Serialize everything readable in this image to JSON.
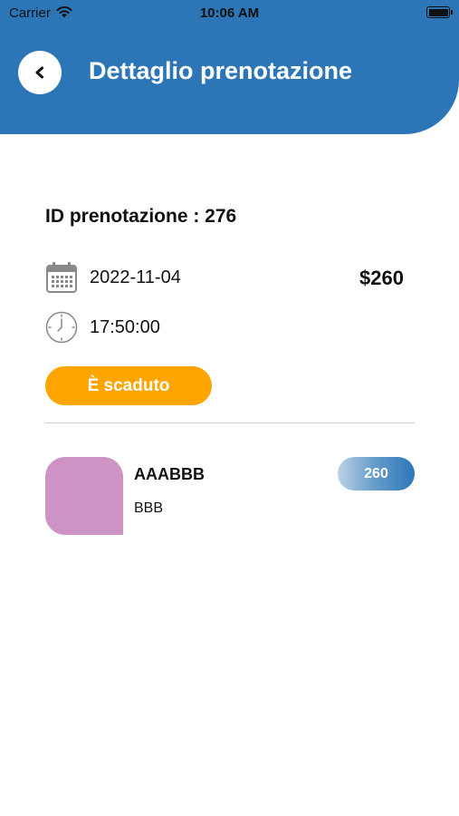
{
  "status_bar": {
    "carrier": "Carrier",
    "time": "10:06 AM",
    "wifi_icon": "wifi-icon",
    "battery_icon": "battery-icon"
  },
  "header": {
    "title": "Dettaglio prenotazione",
    "back_icon": "chevron-left-icon",
    "background_color": "#2c76b8"
  },
  "booking": {
    "id_label": "ID prenotazione : 276",
    "date": "2022-11-04",
    "time": "17:50:00",
    "price": "$260",
    "status": "È scaduto",
    "status_color": "#ffa500",
    "date_icon": "calendar-icon",
    "time_icon": "clock-icon"
  },
  "items": [
    {
      "name": "AAABBB",
      "subtitle": "BBB",
      "badge": "260",
      "image_color": "#cc93c4"
    }
  ]
}
